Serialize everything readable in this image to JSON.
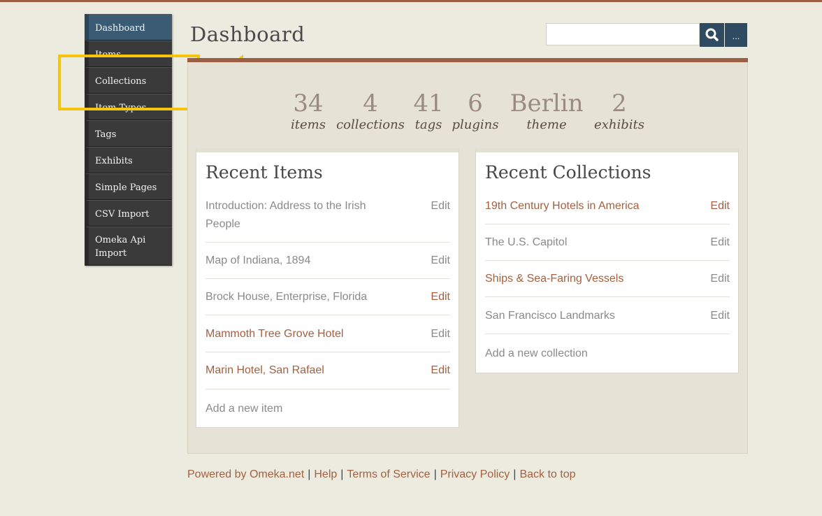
{
  "nav": {
    "items": [
      {
        "label": "Dashboard"
      },
      {
        "label": "Items"
      },
      {
        "label": "Collections"
      },
      {
        "label": "Item Types"
      },
      {
        "label": "Tags"
      },
      {
        "label": "Exhibits"
      },
      {
        "label": "Simple Pages"
      },
      {
        "label": "CSV Import"
      },
      {
        "label": "Omeka Api Import"
      }
    ]
  },
  "header": {
    "title": "Dashboard",
    "search_placeholder": "",
    "more_label": "..."
  },
  "stats": [
    {
      "value": "34",
      "label": "items"
    },
    {
      "value": "4",
      "label": "collections"
    },
    {
      "value": "41",
      "label": "tags"
    },
    {
      "value": "6",
      "label": "plugins"
    },
    {
      "value": "Berlin",
      "label": "theme"
    },
    {
      "value": "2",
      "label": "exhibits"
    }
  ],
  "recent_items": {
    "title": "Recent Items",
    "rows": [
      {
        "title": "Introduction: Address to the Irish People",
        "edit": "Edit"
      },
      {
        "title": "Map of Indiana, 1894",
        "edit": "Edit"
      },
      {
        "title": "Brock House, Enterprise, Florida",
        "edit": "Edit"
      },
      {
        "title": "Mammoth Tree Grove Hotel",
        "edit": "Edit"
      },
      {
        "title": "Marin Hotel, San Rafael",
        "edit": "Edit"
      }
    ],
    "add_label": "Add a new item"
  },
  "recent_collections": {
    "title": "Recent Collections",
    "rows": [
      {
        "title": "19th Century Hotels in America",
        "edit": "Edit"
      },
      {
        "title": "The U.S. Capitol",
        "edit": "Edit"
      },
      {
        "title": "Ships & Sea-Faring Vessels",
        "edit": "Edit"
      },
      {
        "title": "San Francisco Landmarks",
        "edit": "Edit"
      }
    ],
    "add_label": "Add a new collection"
  },
  "footer": {
    "powered": "Powered by Omeka.net",
    "help": "Help",
    "terms": "Terms of Service",
    "privacy": "Privacy Policy",
    "top": "Back to top"
  },
  "colors": {
    "accent": "#9b5f45",
    "link": "#a65f3e",
    "nav_active": "#3b5b75",
    "highlight": "#f7c40d"
  },
  "icons": {
    "search": "search-icon",
    "pointer": "arrow-left-icon"
  }
}
